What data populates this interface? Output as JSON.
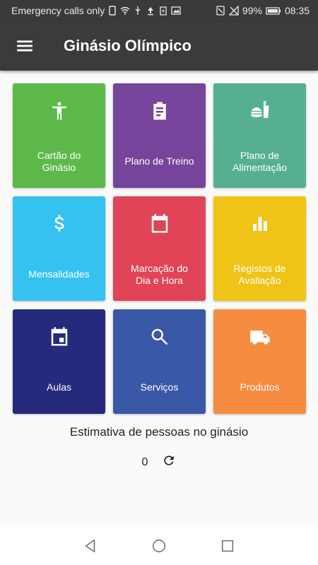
{
  "status": {
    "carrier": "Emergency calls only",
    "battery": "99%",
    "time": "08:35"
  },
  "appbar": {
    "title": "Ginásio Olímpico",
    "menu_icon": "hamburger-icon"
  },
  "tiles": [
    {
      "label": "Cartão do\nGinásio",
      "icon": "person-icon",
      "color": "#5cb94a"
    },
    {
      "label": "Plano de Treino",
      "icon": "clipboard-icon",
      "color": "#76449a"
    },
    {
      "label": "Plano de\nAlimentação",
      "icon": "food-icon",
      "color": "#56b090"
    },
    {
      "label": "Mensalidades",
      "icon": "dollar-icon",
      "color": "#35c2f0"
    },
    {
      "label": "Marcação do\nDia e Hora",
      "icon": "calendar-icon",
      "color": "#e14457"
    },
    {
      "label": "Registos de\nAvaliação",
      "icon": "bar-chart-icon",
      "color": "#efc417"
    },
    {
      "label": "Aulas",
      "icon": "event-icon",
      "color": "#262a7c"
    },
    {
      "label": "Serviços",
      "icon": "search-icon",
      "color": "#3a58a8"
    },
    {
      "label": "Produtos",
      "icon": "truck-icon",
      "color": "#f68c40"
    }
  ],
  "estimate": {
    "label": "Estimativa de pessoas no ginásio",
    "count": "0"
  }
}
